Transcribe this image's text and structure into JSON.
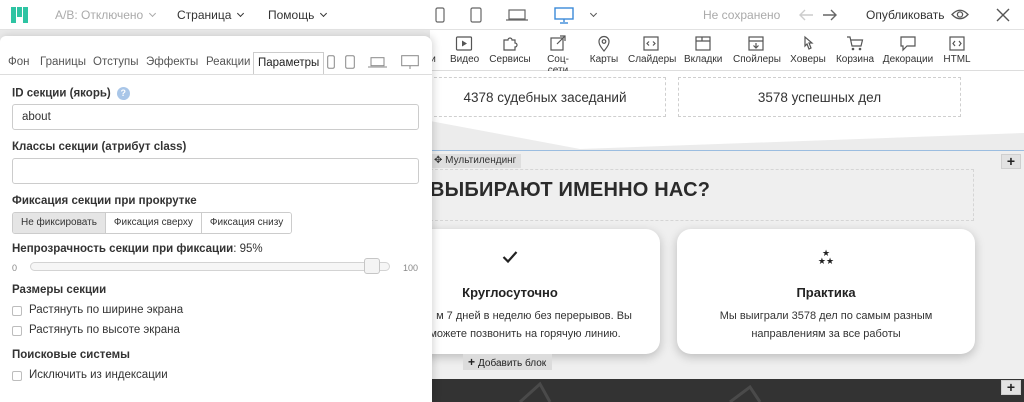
{
  "topbar": {
    "ab_label": "A/B: Отключено",
    "page_menu": "Страница",
    "help_menu": "Помощь",
    "save_status": "Не сохранено",
    "publish_label": "Опубликовать",
    "accent_color": "#2ec4a3",
    "device_active": "desktop"
  },
  "widgets": [
    {
      "icon": "video-icon",
      "label": "Видео"
    },
    {
      "icon": "puzzle-icon",
      "label": "Сервисы"
    },
    {
      "icon": "share-icon",
      "label": "Соц-сети"
    },
    {
      "icon": "map-pin-icon",
      "label": "Карты"
    },
    {
      "icon": "slider-icon",
      "label": "Слайдеры"
    },
    {
      "icon": "tabs-icon",
      "label": "Вкладки"
    },
    {
      "icon": "spoiler-icon",
      "label": "Спойлеры"
    },
    {
      "icon": "cursor-icon",
      "label": "Ховеры"
    },
    {
      "icon": "cart-icon",
      "label": "Корзина"
    },
    {
      "icon": "speech-icon",
      "label": "Декорации"
    },
    {
      "icon": "code-icon",
      "label": "HTML"
    }
  ],
  "canvas": {
    "stat_left": "4378 судебных заседаний",
    "stat_right": "3578 успешных дел",
    "section_tag": "Мультилендинг",
    "heading": "ВЫБИРАЮТ ИМЕННО НАС?",
    "card1": {
      "icon": "check-icon",
      "title": "Круглосуточно",
      "line1": "м 7 дней в неделю без перерывов. Вы",
      "line2": "можете позвонить на горячую линию."
    },
    "card2": {
      "icon": "stars-icon",
      "title": "Практика",
      "line1": "Мы выиграли 3578 дел по самым разным",
      "line2": "направлениям за все работы"
    },
    "add_block": "Добавить блок"
  },
  "panel": {
    "tabs": [
      "Фон",
      "Границы",
      "Отступы",
      "Эффекты",
      "Реакции",
      "Параметры"
    ],
    "active_tab": "Параметры",
    "anchor_label": "ID секции (якорь)",
    "anchor_value": "about",
    "classes_label": "Классы секции (атрибут class)",
    "classes_value": "",
    "fix_label": "Фиксация секции при прокрутке",
    "fix_options": [
      "Не фиксировать",
      "Фиксация сверху",
      "Фиксация снизу"
    ],
    "fix_selected": "Не фиксировать",
    "opacity_label": "Непрозрачность секции при фиксации",
    "opacity_value": ": 95%",
    "opacity_fraction": 0.95,
    "slider_min": "0",
    "slider_max": "100",
    "sizes_label": "Размеры секции",
    "stretch_width": "Растянуть по ширине экрана",
    "stretch_height": "Растянуть по высоте экрана",
    "seo_label": "Поисковые системы",
    "exclude_index": "Исключить из индексации"
  }
}
